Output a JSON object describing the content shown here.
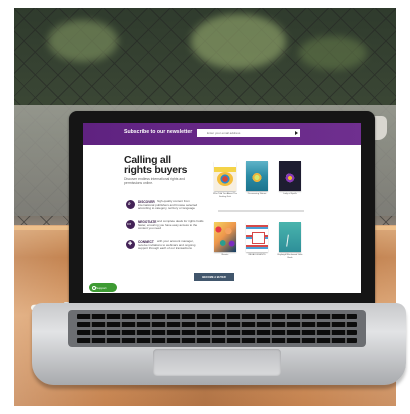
{
  "newsletter": {
    "title": "Subscribe to our newsletter",
    "email_placeholder": "Enter your email address"
  },
  "hero": {
    "headline": "Calling all rights buyers",
    "intro": "Discover endless international rights and permissions online."
  },
  "features": [
    {
      "title": "DISCOVER",
      "text": "high-quality content from international publishers and browse selected according to category, territory or language"
    },
    {
      "title": "NEGOTIATE",
      "text": "and complete deals for rights holds faster, ensuring you have easy access to the content you need"
    },
    {
      "title": "CONNECT",
      "text": "with your account manager, receive invitations to webinars and ongoing support through each of our transactions"
    }
  ],
  "books": [
    {
      "caption": "Who Told You About The Smiling Fish"
    },
    {
      "caption": "Discovering Nature"
    },
    {
      "caption": "Lady of Spells"
    },
    {
      "caption": "Beasts"
    },
    {
      "caption": "INDIA DISSENTS"
    },
    {
      "caption": "Rayleigh Blackwood Little Book"
    }
  ],
  "actions": {
    "become_buyer": "BECOME A BUYER",
    "support": "Support"
  }
}
